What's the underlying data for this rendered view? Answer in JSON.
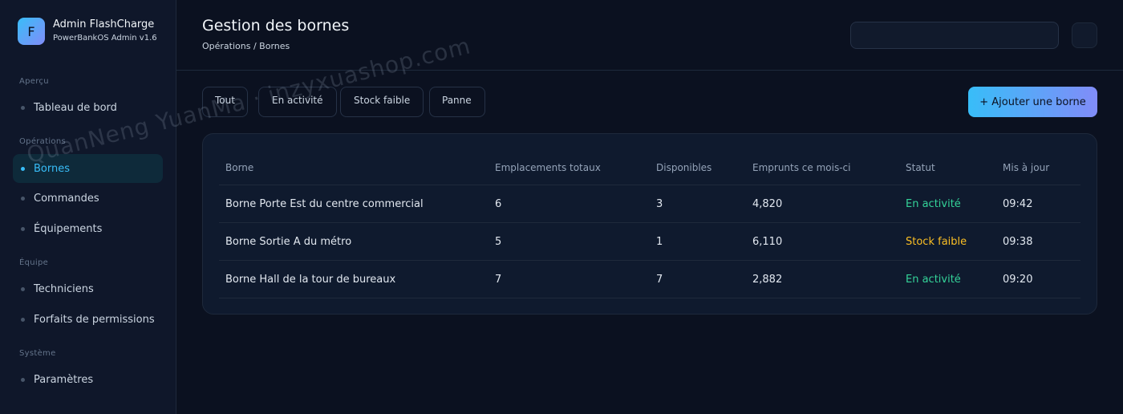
{
  "brand": {
    "logo_letter": "F",
    "title": "Admin FlashCharge",
    "subtitle": "PowerBankOS Admin v1.6"
  },
  "sidebar": {
    "sections": [
      {
        "label": "Aperçu"
      },
      {
        "label": "Opérations"
      },
      {
        "label": "Équipe"
      },
      {
        "label": "Système"
      }
    ],
    "items": [
      {
        "label": "Tableau de bord"
      },
      {
        "label": "Bornes"
      },
      {
        "label": "Commandes"
      },
      {
        "label": "Équipements"
      },
      {
        "label": "Techniciens"
      },
      {
        "label": "Forfaits de permissions"
      },
      {
        "label": "Paramètres"
      }
    ],
    "active_item": "Bornes"
  },
  "header": {
    "title": "Gestion des bornes",
    "breadcrumb": "Opérations / Bornes",
    "search_value": ""
  },
  "filters": [
    {
      "label": "Tout"
    },
    {
      "label": "En activité"
    },
    {
      "label": "Stock faible"
    },
    {
      "label": "Panne"
    }
  ],
  "actions": {
    "add_label": "+ Ajouter une borne"
  },
  "table": {
    "columns": [
      "Borne",
      "Emplacements totaux",
      "Disponibles",
      "Emprunts ce mois-ci",
      "Statut",
      "Mis à jour"
    ],
    "rows": [
      {
        "name": "Borne Porte Est du centre commercial",
        "total": "6",
        "available": "3",
        "loans": "4,820",
        "status": "En activité",
        "updated": "09:42"
      },
      {
        "name": "Borne Sortie A du métro",
        "total": "5",
        "available": "1",
        "loans": "6,110",
        "status": "Stock faible",
        "updated": "09:38"
      },
      {
        "name": "Borne Hall de la tour de bureaux",
        "total": "7",
        "available": "7",
        "loans": "2,882",
        "status": "En activité",
        "updated": "09:20"
      }
    ]
  },
  "watermark": "QuanNeng YuanMa · inzyxuashop.com",
  "colors": {
    "accent": "#38bdf8",
    "accent_secondary": "#818cf8",
    "status_active": "#34d399",
    "status_low": "#fbbf24"
  }
}
